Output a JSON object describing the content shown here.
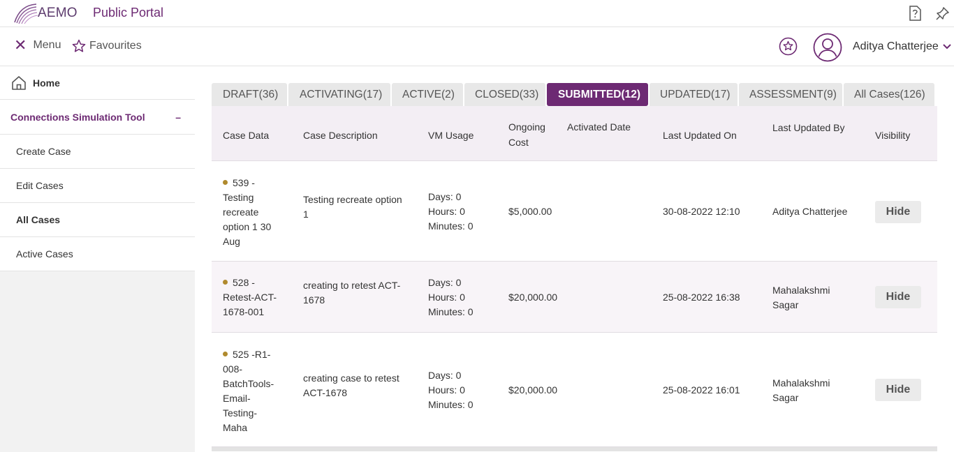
{
  "header": {
    "logo_text": "AEMO",
    "portal_title": "Public Portal",
    "help_icon": "help-icon",
    "pin_icon": "pin-icon"
  },
  "subbar": {
    "menu_label": "Menu",
    "favourites_label": "Favourites",
    "user_name": "Aditya Chatterjee"
  },
  "sidebar": {
    "home_label": "Home",
    "section_label": "Connections Simulation Tool",
    "section_toggle": "–",
    "items": [
      {
        "label": "Create Case"
      },
      {
        "label": "Edit Cases"
      },
      {
        "label": "All Cases"
      },
      {
        "label": "Active Cases"
      }
    ]
  },
  "tabs": [
    {
      "label": "DRAFT(36)"
    },
    {
      "label": "ACTIVATING(17)"
    },
    {
      "label": "ACTIVE(2)"
    },
    {
      "label": "CLOSED(33)"
    },
    {
      "label": "SUBMITTED(12)"
    },
    {
      "label": "UPDATED(17)"
    },
    {
      "label": "ASSESSMENT(9)"
    },
    {
      "label": "All Cases(126)"
    }
  ],
  "table": {
    "headers": {
      "case_data": "Case Data",
      "case_description": "Case Description",
      "vm_usage": "VM Usage",
      "ongoing_cost_1": "Ongoing",
      "ongoing_cost_2": "Cost",
      "activated_date": "Activated Date",
      "last_updated_on": "Last Updated On",
      "last_updated_by": "Last Updated By",
      "visibility": "Visibility"
    },
    "rows": [
      {
        "case_lines": [
          "539 -",
          "Testing",
          "recreate",
          "option 1 30",
          "Aug"
        ],
        "desc_lines": [
          "Testing recreate option",
          "1"
        ],
        "vm_lines": [
          "Days: 0",
          "Hours: 0",
          "Minutes: 0"
        ],
        "cost": "$5,000.00",
        "updated_on": "30-08-2022 12:10",
        "updated_by_lines": [
          "Aditya Chatterjee"
        ],
        "action": "Hide"
      },
      {
        "case_lines": [
          "528 -",
          "Retest-ACT-",
          "1678-001"
        ],
        "desc_lines": [
          "creating to retest ACT-",
          "1678"
        ],
        "vm_lines": [
          "Days: 0",
          "Hours: 0",
          "Minutes: 0"
        ],
        "cost": "$20,000.00",
        "updated_on": "25-08-2022 16:38",
        "updated_by_lines": [
          "Mahalakshmi",
          "Sagar"
        ],
        "action": "Hide"
      },
      {
        "case_lines": [
          "525 -R1-",
          "008-",
          "BatchTools-",
          "Email-",
          "Testing-",
          "Maha"
        ],
        "desc_lines": [
          "creating case to retest",
          "ACT-1678"
        ],
        "vm_lines": [
          "Days: 0",
          "Hours: 0",
          "Minutes: 0"
        ],
        "cost": "$20,000.00",
        "updated_on": "25-08-2022 16:01",
        "updated_by_lines": [
          "Mahalakshmi",
          "Sagar"
        ],
        "action": "Hide"
      }
    ]
  },
  "colors": {
    "brand": "#6d2a73",
    "status_dot": "#b08a2d"
  }
}
